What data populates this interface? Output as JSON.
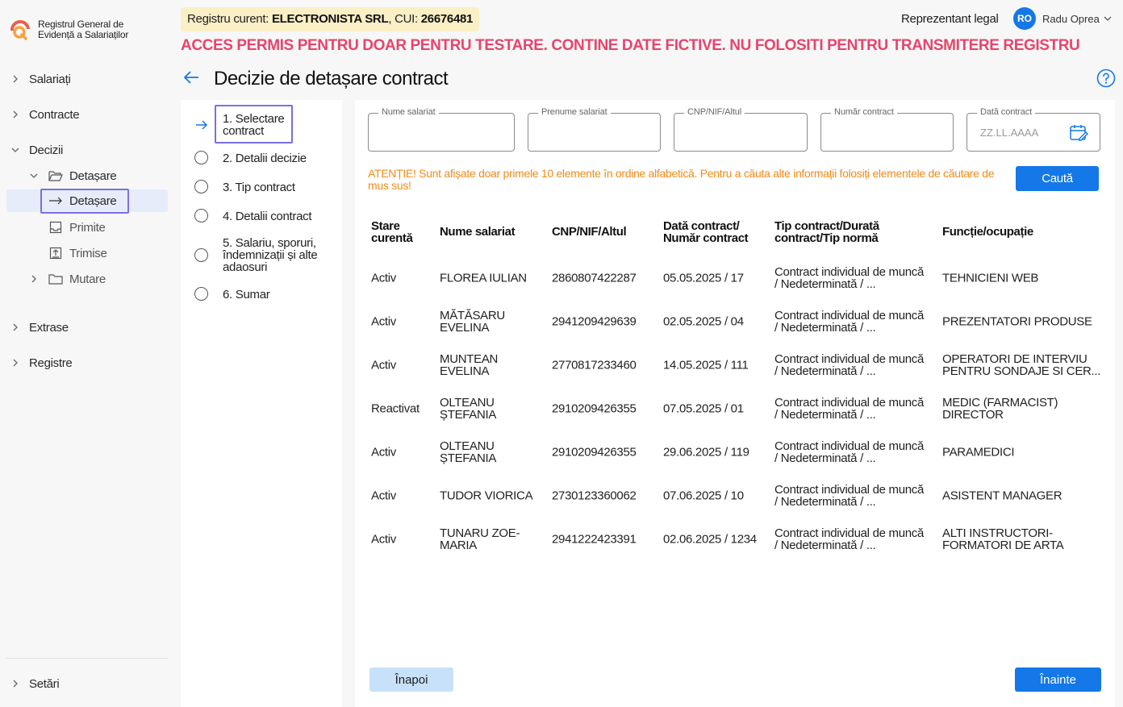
{
  "app": {
    "logo_line1": "Registrul General de",
    "logo_line2": "Evidență a Salariaților"
  },
  "sidebar": {
    "items": [
      {
        "label": "Salariați"
      },
      {
        "label": "Contracte"
      },
      {
        "label": "Decizii"
      },
      {
        "label": "Detașare"
      },
      {
        "label": "Detașare"
      },
      {
        "label": "Primite"
      },
      {
        "label": "Trimise"
      },
      {
        "label": "Mutare"
      },
      {
        "label": "Extrase"
      },
      {
        "label": "Registre"
      },
      {
        "label": "Setări"
      }
    ]
  },
  "header": {
    "registry_prefix": "Registru curent: ",
    "registry_name": "ELECTRONISTA SRL",
    "cui_prefix": ", CUI: ",
    "cui": "26676481",
    "rep_label": "Reprezentant legal",
    "avatar_initials": "RO",
    "user_name": "Radu Oprea",
    "warning": "ACCES PERMIS PENTRU DOAR PENTRU TESTARE. CONTINE DATE FICTIVE. NU FOLOSITI PENTRU TRANSMITERE REGISTRU"
  },
  "page": {
    "title": "Decizie de detașare contract"
  },
  "steps": [
    {
      "label": "1. Selectare contract"
    },
    {
      "label": "2. Detalii decizie"
    },
    {
      "label": "3. Tip contract"
    },
    {
      "label": "4. Detalii contract"
    },
    {
      "label": "5. Salariu, sporuri, îndemnizații și alte adaosuri"
    },
    {
      "label": "6. Sumar"
    }
  ],
  "filters": {
    "nume": "Nume salariat",
    "prenume": "Prenume salariat",
    "cnp": "CNP/NIF/Altul",
    "numar": "Număr contract",
    "data": "Dată contract",
    "data_placeholder": "ZZ.LL.AAAA"
  },
  "notice": "ATENȚIE! Sunt afișate doar primele 10 elemente în ordine alfabetică. Pentru a căuta alte informații folosiți elementele de căutare de mus sus!",
  "search_button": "Caută",
  "table": {
    "headers": {
      "stare": "Stare curentă",
      "nume": "Nume salariat",
      "cnp": "CNP/NIF/Altul",
      "data": "Dată contract/ Număr contract",
      "tip": "Tip contract/Durată contract/Tip normă",
      "functie": "Funcție/ocupație"
    },
    "rows": [
      {
        "stare": "Activ",
        "nume": "FLOREA IULIAN",
        "cnp": "2860807422287",
        "data": "05.05.2025 / 17",
        "tip": "Contract individual de muncă / Nedeterminată / ...",
        "functie": "TEHNICIENI WEB"
      },
      {
        "stare": "Activ",
        "nume": "MĂTĂSARU EVELINA",
        "cnp": "2941209429639",
        "data": "02.05.2025 / 04",
        "tip": "Contract individual de muncă / Nedeterminată / ...",
        "functie": "PREZENTATORI PRODUSE"
      },
      {
        "stare": "Activ",
        "nume": "MUNTEAN EVELINA",
        "cnp": "2770817233460",
        "data": "14.05.2025 / 111",
        "tip": "Contract individual de muncă / Nedeterminată / ...",
        "functie": "OPERATORI DE INTERVIU PENTRU SONDAJE SI CER..."
      },
      {
        "stare": "Reactivat",
        "nume": "OLTEANU ȘTEFANIA",
        "cnp": "2910209426355",
        "data": "07.05.2025 / 01",
        "tip": "Contract individual de muncă / Nedeterminată / ...",
        "functie": "MEDIC (FARMACIST) DIRECTOR"
      },
      {
        "stare": "Activ",
        "nume": "OLTEANU ȘTEFANIA",
        "cnp": "2910209426355",
        "data": "29.06.2025 / 119",
        "tip": "Contract individual de muncă / Nedeterminată / ...",
        "functie": "PARAMEDICI"
      },
      {
        "stare": "Activ",
        "nume": "TUDOR VIORICA",
        "cnp": "2730123360062",
        "data": "07.06.2025 / 10",
        "tip": "Contract individual de muncă / Nedeterminată / ...",
        "functie": "ASISTENT MANAGER"
      },
      {
        "stare": "Activ",
        "nume": "TUNARU ZOE-MARIA",
        "cnp": "2941222423391",
        "data": "02.06.2025 / 1234",
        "tip": "Contract individual de muncă / Nedeterminată / ...",
        "functie": "ALTI INSTRUCTORI-FORMATORI DE ARTA"
      }
    ]
  },
  "footer": {
    "back": "Înapoi",
    "next": "Înainte"
  },
  "colors": {
    "primary": "#1478e8",
    "warning": "#e8446a",
    "notice": "#f28a1a",
    "focus": "#7b6fe2",
    "badge": "#fbefc6"
  }
}
